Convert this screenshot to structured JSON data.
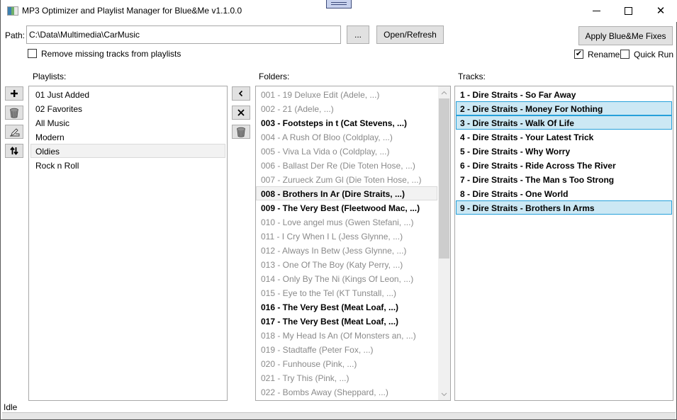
{
  "window": {
    "title": "MP3 Optimizer and Playlist Manager for Blue&Me v1.1.0.0",
    "app_icon": "app-window-icon",
    "controls": {
      "minimize": "minimize-icon",
      "maximize": "maximize-icon",
      "close": "close-icon",
      "close_glyph": "✕"
    }
  },
  "path": {
    "label": "Path:",
    "value": "C:\\Data\\Multimedia\\CarMusic",
    "browse_label": "...",
    "open_label": "Open/Refresh"
  },
  "options": {
    "remove_missing": {
      "label": "Remove missing tracks from playlists",
      "checked": false
    },
    "apply_label": "Apply Blue&Me Fixes",
    "rename": {
      "label": "Rename",
      "checked": true,
      "glyph": "✔"
    },
    "quick_run": {
      "label": "Quick Run",
      "checked": false
    }
  },
  "playlists": {
    "label": "Playlists:",
    "buttons": [
      {
        "name": "add-playlist",
        "icon": "plus-icon"
      },
      {
        "name": "delete-playlist",
        "icon": "trash-icon"
      },
      {
        "name": "rename-playlist",
        "icon": "edit-pen-icon"
      },
      {
        "name": "sort-playlist",
        "icon": "sort-arrows-icon"
      }
    ],
    "items": [
      {
        "label": "01 Just Added"
      },
      {
        "label": "02 Favorites"
      },
      {
        "label": "All Music"
      },
      {
        "label": "Modern"
      },
      {
        "label": "Oldies",
        "hover": true
      },
      {
        "label": "Rock n Roll"
      }
    ]
  },
  "folders": {
    "label": "Folders:",
    "buttons": [
      {
        "name": "add-to-playlist",
        "icon": "chevron-left-icon",
        "glyph": "‹"
      },
      {
        "name": "remove-from-playlist",
        "icon": "close-icon",
        "glyph": "✕"
      },
      {
        "name": "delete-folder",
        "icon": "trash-icon"
      }
    ],
    "items": [
      {
        "label": "001 - 19 Deluxe Edit (Adele, ...)",
        "bold": false
      },
      {
        "label": "002 - 21 (Adele, ...)",
        "bold": false
      },
      {
        "label": "003 - Footsteps in t (Cat Stevens, ...)",
        "bold": true
      },
      {
        "label": "004 - A Rush Of Bloo (Coldplay, ...)",
        "bold": false
      },
      {
        "label": "005 - Viva La Vida o (Coldplay, ...)",
        "bold": false
      },
      {
        "label": "006 - Ballast Der Re (Die Toten Hose, ...)",
        "bold": false
      },
      {
        "label": "007 - Zurueck Zum Gl (Die Toten Hose, ...)",
        "bold": false
      },
      {
        "label": "008 - Brothers In Ar (Dire Straits, ...)",
        "bold": true,
        "hover": true
      },
      {
        "label": "009 - The Very Best (Fleetwood Mac, ...)",
        "bold": true
      },
      {
        "label": "010 - Love angel mus (Gwen Stefani, ...)",
        "bold": false
      },
      {
        "label": "011 - I Cry When I L (Jess Glynne, ...)",
        "bold": false
      },
      {
        "label": "012 - Always In Betw (Jess Glynne, ...)",
        "bold": false
      },
      {
        "label": "013 - One Of The Boy (Katy Perry, ...)",
        "bold": false
      },
      {
        "label": "014 - Only By The Ni (Kings Of Leon, ...)",
        "bold": false
      },
      {
        "label": "015 - Eye to the Tel (KT Tunstall, ...)",
        "bold": false
      },
      {
        "label": "016 - The Very Best (Meat Loaf, ...)",
        "bold": true
      },
      {
        "label": "017 - The Very Best (Meat Loaf, ...)",
        "bold": true
      },
      {
        "label": "018 - My Head Is An (Of Monsters an, ...)",
        "bold": false
      },
      {
        "label": "019 - Stadtaffe (Peter Fox, ...)",
        "bold": false
      },
      {
        "label": "020 - Funhouse (Pink, ...)",
        "bold": false
      },
      {
        "label": "021 - Try This (Pink, ...)",
        "bold": false
      },
      {
        "label": "022 - Bombs Away (Sheppard, ...)",
        "bold": false
      }
    ],
    "scrollbar": {
      "up_glyph": "^",
      "down_glyph": "v",
      "position_fraction": 0.0,
      "visible_fraction": 0.55
    }
  },
  "tracks": {
    "label": "Tracks:",
    "items": [
      {
        "label": "1 - Dire Straits - So Far Away",
        "selected": false
      },
      {
        "label": "2 - Dire Straits - Money For Nothing",
        "selected": true
      },
      {
        "label": "3 - Dire Straits - Walk Of Life",
        "selected": true
      },
      {
        "label": "4 - Dire Straits - Your Latest Trick",
        "selected": false
      },
      {
        "label": "5 - Dire Straits - Why Worry",
        "selected": false
      },
      {
        "label": "6 - Dire Straits - Ride Across The River",
        "selected": false
      },
      {
        "label": "7 - Dire Straits - The Man s Too Strong",
        "selected": false
      },
      {
        "label": "8 - Dire Straits - One World",
        "selected": false
      },
      {
        "label": "9 - Dire Straits - Brothers In Arms",
        "selected": true,
        "focused": true
      }
    ]
  },
  "status": {
    "text": "Idle"
  },
  "colors": {
    "selection_bg": "#cce8f4",
    "selection_border": "#26a0da",
    "disabled_text": "#8a8a8a",
    "button_bg": "#e1e1e1"
  }
}
